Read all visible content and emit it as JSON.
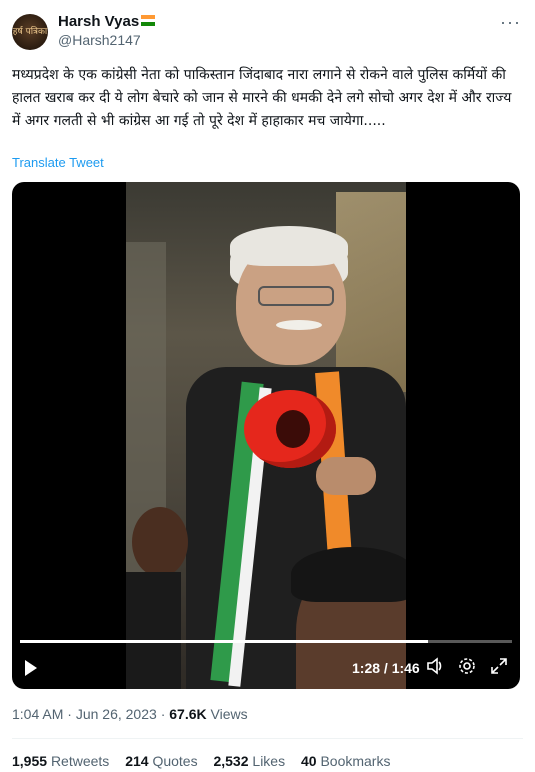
{
  "author": {
    "name": "Harsh Vyas",
    "handle": "@Harsh2147",
    "avatar_text": "हर्ष पत्रिका",
    "flag_colors": [
      "#ff9933",
      "#ffffff",
      "#138808"
    ]
  },
  "more_icon": "more-horizontal-icon",
  "tweet_text": "मध्यप्रदेश के एक कांग्रेसी नेता को पाकिस्तान जिंदाबाद नारा लगाने से रोकने वाले पुलिस कर्मियों की हालत खराब कर दी ये लोग बेचारे को जान से मारने की धमकी देने लगे सोचो अगर देश में और राज्य में अगर गलती से भी कांग्रेस आ गई तो पूरे देश में हाहाकार मच जायेगा.....",
  "translate_label": "Translate Tweet",
  "video": {
    "progress": 0.83,
    "time": "1:28 / 1:46",
    "controls": [
      "play-icon",
      "volume-icon",
      "settings-icon",
      "fullscreen-icon"
    ]
  },
  "meta": {
    "time": "1:04 AM",
    "date": "Jun 26, 2023",
    "views_count": "67.6K",
    "views_label": "Views"
  },
  "stats": [
    {
      "count": "1,955",
      "label": "Retweets"
    },
    {
      "count": "214",
      "label": "Quotes"
    },
    {
      "count": "2,532",
      "label": "Likes"
    },
    {
      "count": "40",
      "label": "Bookmarks"
    }
  ],
  "colors": {
    "link": "#1d9bf0",
    "secondary": "#536471",
    "primary_text": "#0f1419"
  }
}
